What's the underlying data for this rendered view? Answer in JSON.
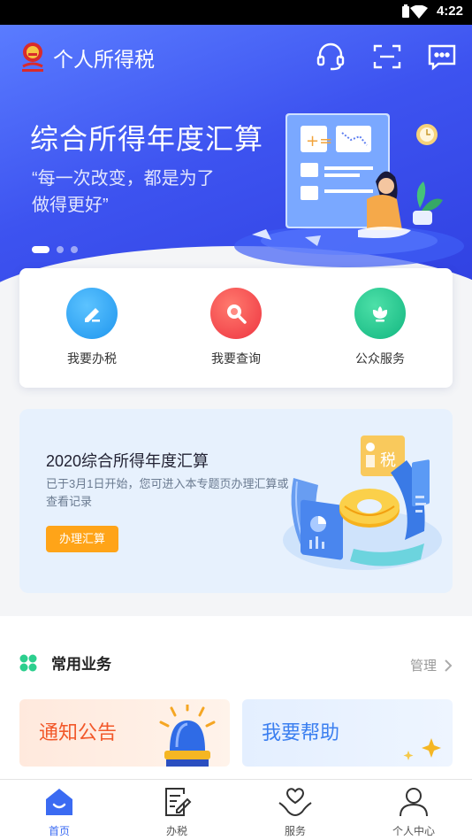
{
  "status_bar": {
    "time": "4:22",
    "wifi_icon": "wifi-icon",
    "battery_icon": "battery-icon"
  },
  "header": {
    "title": "个人所得税",
    "logo": "tax-emblem-logo",
    "icons": [
      "headset-icon",
      "scan-icon",
      "message-icon"
    ]
  },
  "banner": {
    "title": "综合所得年度汇算",
    "quote_line1": "“每一次改变，都是为了",
    "quote_line2": "做得更好”",
    "slide_count": 3,
    "active_slide": 1
  },
  "quick_actions": [
    {
      "label": "我要办税",
      "icon": "pencil-edit-icon",
      "color": "#2fa6f1"
    },
    {
      "label": "我要查询",
      "icon": "magnifier-icon",
      "color": "#f2464a"
    },
    {
      "label": "公众服务",
      "icon": "lotus-flower-icon",
      "color": "#19c38a"
    }
  ],
  "promo": {
    "title": "2020综合所得年度汇算",
    "description": "已于3月1日开始，您可进入本专题页办理汇算或查看记录",
    "button_label": "办理汇算",
    "illustration_tag": "税"
  },
  "common_business": {
    "title": "常用业务",
    "manage_label": "管理",
    "cards": [
      {
        "label": "通知公告",
        "color": "#f2582a",
        "icon": "bell-icon"
      },
      {
        "label": "我要帮助",
        "color": "#3b7ff0",
        "icon": "sparkle-icon"
      }
    ]
  },
  "tabbar": {
    "items": [
      {
        "label": "首页",
        "icon": "home-icon",
        "active": true
      },
      {
        "label": "办税",
        "icon": "document-edit-icon",
        "active": false
      },
      {
        "label": "服务",
        "icon": "heart-hands-icon",
        "active": false
      },
      {
        "label": "个人中心",
        "icon": "person-icon",
        "active": false
      }
    ],
    "active_color": "#3b6bf2"
  }
}
